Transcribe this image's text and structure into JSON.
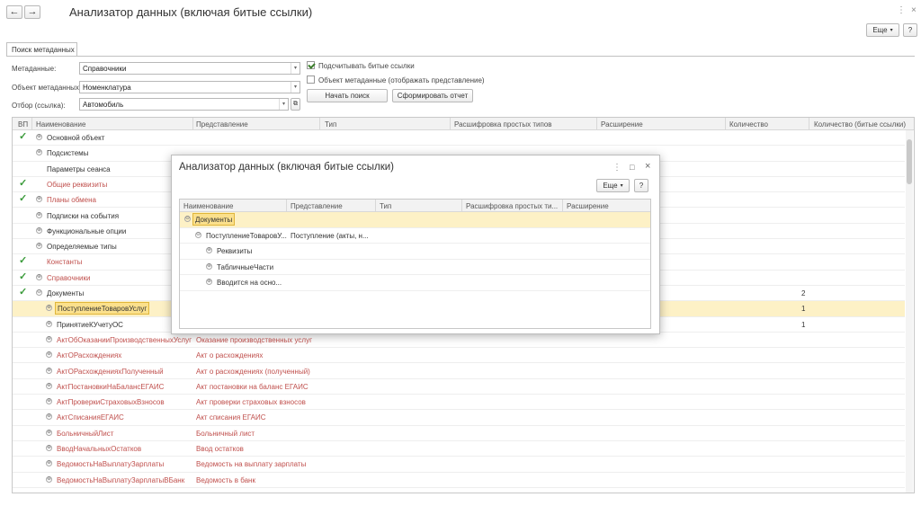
{
  "window": {
    "title": "Анализатор данных (включая битые ссылки)",
    "back": "←",
    "forward": "→",
    "more_label": "Еще",
    "help_label": "?"
  },
  "tab": {
    "label": "Поиск метаданных"
  },
  "form": {
    "metadata_label": "Метаданные:",
    "metadata_value": "Справочники",
    "object_label": "Объект метаданных:",
    "object_value": "Номенклатура",
    "filter_label": "Отбор (ссылка):",
    "filter_value": "Автомобиль",
    "count_broken_label": "Подсчитывать битые ссылки",
    "count_broken_checked": true,
    "show_repr_label": "Объект метаданные (отображать представление)",
    "show_repr_checked": false,
    "search_button": "Начать поиск",
    "report_button": "Сформировать отчет"
  },
  "grid": {
    "columns": [
      "ВП",
      "Наименование",
      "Представление",
      "Тип",
      "Расшифровка простых типов",
      "Расширение",
      "Количество",
      "Количество (битые ссылки)"
    ],
    "rows": [
      {
        "vp": true,
        "expander": "⊕",
        "name": "Основной объект",
        "repr": "",
        "count": "",
        "red": false,
        "indent": 0
      },
      {
        "vp": false,
        "expander": "⊕",
        "name": "Подсистемы",
        "repr": "",
        "count": "",
        "red": false,
        "indent": 0
      },
      {
        "vp": false,
        "expander": "",
        "name": "Параметры сеанса",
        "repr": "",
        "count": "",
        "red": false,
        "indent": 0
      },
      {
        "vp": true,
        "expander": "",
        "name": "Общие реквизиты",
        "repr": "",
        "count": "",
        "red": true,
        "indent": 0
      },
      {
        "vp": true,
        "expander": "⊕",
        "name": "Планы обмена",
        "repr": "",
        "count": "",
        "red": true,
        "indent": 0
      },
      {
        "vp": false,
        "expander": "⊕",
        "name": "Подписки на события",
        "repr": "",
        "count": "",
        "red": false,
        "indent": 0
      },
      {
        "vp": false,
        "expander": "⊕",
        "name": "Функциональные опции",
        "repr": "",
        "count": "",
        "red": false,
        "indent": 0
      },
      {
        "vp": false,
        "expander": "⊕",
        "name": "Определяемые типы",
        "repr": "",
        "count": "",
        "red": false,
        "indent": 0
      },
      {
        "vp": true,
        "expander": "",
        "name": "Константы",
        "repr": "",
        "count": "",
        "red": true,
        "indent": 0
      },
      {
        "vp": true,
        "expander": "⊕",
        "name": "Справочники",
        "repr": "",
        "count": "",
        "red": true,
        "indent": 0
      },
      {
        "vp": true,
        "expander": "⊖",
        "name": "Документы",
        "repr": "",
        "count": "2",
        "red": false,
        "indent": 0
      },
      {
        "vp": false,
        "expander": "⊕",
        "name": "ПоступлениеТоваровУслуг",
        "repr": "",
        "count": "1",
        "red": false,
        "indent": 1,
        "selected": true
      },
      {
        "vp": false,
        "expander": "⊕",
        "name": "ПринятиеКУчетуОС",
        "repr": "",
        "count": "1",
        "red": false,
        "indent": 1
      },
      {
        "vp": false,
        "expander": "⊕",
        "name": "АктОбОказанииПроизводственныхУслуг",
        "repr": "Оказание производственных услуг",
        "count": "",
        "red": true,
        "indent": 1
      },
      {
        "vp": false,
        "expander": "⊕",
        "name": "АктОРасхождениях",
        "repr": "Акт о расхождениях",
        "count": "",
        "red": true,
        "indent": 1
      },
      {
        "vp": false,
        "expander": "⊕",
        "name": "АктОРасхожденияхПолученный",
        "repr": "Акт о расхождениях (полученный)",
        "count": "",
        "red": true,
        "indent": 1
      },
      {
        "vp": false,
        "expander": "⊕",
        "name": "АктПостановкиНаБалансЕГАИС",
        "repr": "Акт постановки на баланс ЕГАИС",
        "count": "",
        "red": true,
        "indent": 1
      },
      {
        "vp": false,
        "expander": "⊕",
        "name": "АктПроверкиСтраховыхВзносов",
        "repr": "Акт проверки страховых взносов",
        "count": "",
        "red": true,
        "indent": 1
      },
      {
        "vp": false,
        "expander": "⊕",
        "name": "АктСписанияЕГАИС",
        "repr": "Акт списания ЕГАИС",
        "count": "",
        "red": true,
        "indent": 1
      },
      {
        "vp": false,
        "expander": "⊕",
        "name": "БольничныйЛист",
        "repr": "Больничный лист",
        "count": "",
        "red": true,
        "indent": 1
      },
      {
        "vp": false,
        "expander": "⊕",
        "name": "ВводНачальныхОстатков",
        "repr": "Ввод остатков",
        "count": "",
        "red": true,
        "indent": 1
      },
      {
        "vp": false,
        "expander": "⊕",
        "name": "ВедомостьНаВыплатуЗарплаты",
        "repr": "Ведомость на выплату зарплаты",
        "count": "",
        "red": true,
        "indent": 1
      },
      {
        "vp": false,
        "expander": "⊕",
        "name": "ВедомостьНаВыплатуЗарплатыВБанк",
        "repr": "Ведомость в банк",
        "count": "",
        "red": true,
        "indent": 1
      }
    ]
  },
  "modal": {
    "title": "Анализатор данных (включая битые ссылки)",
    "more_label": "Еще",
    "help_label": "?",
    "columns": [
      "Наименование",
      "Представление",
      "Тип",
      "Расшифровка простых ти...",
      "Расширение"
    ],
    "rows": [
      {
        "expander": "⊖",
        "name": "Документы",
        "repr": "",
        "indent": 0,
        "selected": true
      },
      {
        "expander": "⊖",
        "name": "ПоступлениеТоваровУ...",
        "repr": "Поступление (акты, н...",
        "indent": 1
      },
      {
        "expander": "⊕",
        "name": "Реквизиты",
        "repr": "",
        "indent": 2
      },
      {
        "expander": "⊕",
        "name": "ТабличныеЧасти",
        "repr": "",
        "indent": 2
      },
      {
        "expander": "⊕",
        "name": "Вводится на осно...",
        "repr": "",
        "indent": 2
      }
    ]
  },
  "colors": {
    "accent_red": "#c0504d",
    "selection": "#fdf1c6",
    "check": "#3a9a3a"
  }
}
